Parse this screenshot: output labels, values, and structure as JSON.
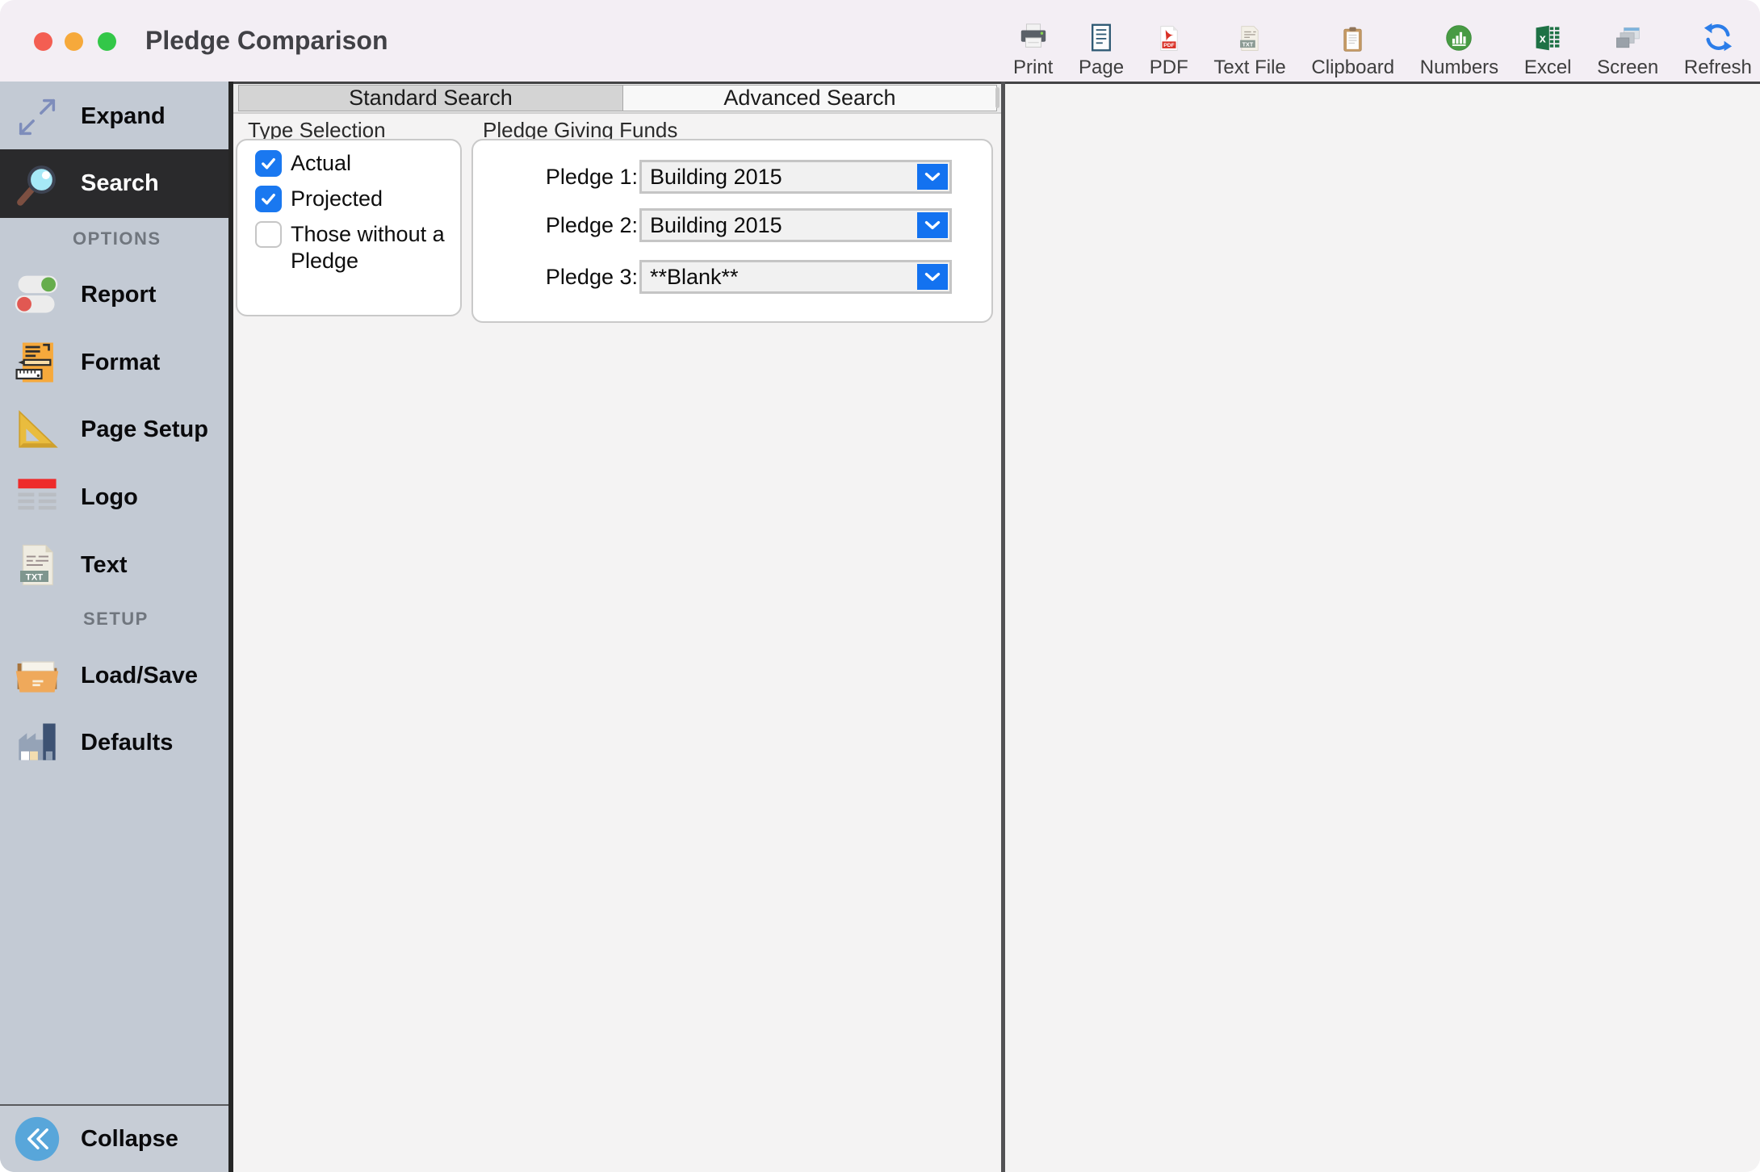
{
  "window": {
    "title": "Pledge Comparison"
  },
  "toolbar": {
    "items": [
      {
        "icon": "print-icon",
        "label": "Print"
      },
      {
        "icon": "page-icon",
        "label": "Page"
      },
      {
        "icon": "pdf-icon",
        "label": "PDF"
      },
      {
        "icon": "text-file-icon",
        "label": "Text File"
      },
      {
        "icon": "clipboard-icon",
        "label": "Clipboard"
      },
      {
        "icon": "numbers-icon",
        "label": "Numbers"
      },
      {
        "icon": "excel-icon",
        "label": "Excel"
      },
      {
        "icon": "screen-icon",
        "label": "Screen"
      },
      {
        "icon": "refresh-icon",
        "label": "Refresh"
      }
    ]
  },
  "sidebar": {
    "expand_label": "Expand",
    "search_label": "Search",
    "options_header": "OPTIONS",
    "options_items": [
      {
        "icon": "report-icon",
        "label": "Report"
      },
      {
        "icon": "format-icon",
        "label": "Format"
      },
      {
        "icon": "page-setup-icon",
        "label": "Page Setup"
      },
      {
        "icon": "logo-icon",
        "label": "Logo"
      },
      {
        "icon": "text-icon",
        "label": "Text"
      }
    ],
    "setup_header": "SETUP",
    "setup_items": [
      {
        "icon": "load-save-icon",
        "label": "Load/Save"
      },
      {
        "icon": "defaults-icon",
        "label": "Defaults"
      }
    ],
    "collapse_label": "Collapse"
  },
  "tabs": {
    "standard": "Standard Search",
    "advanced": "Advanced Search",
    "selected": "Standard Search"
  },
  "search_panel": {
    "type_selection": {
      "legend": "Type Selection",
      "options": [
        {
          "label": "Actual",
          "checked": true
        },
        {
          "label": "Projected",
          "checked": true
        },
        {
          "label": "Those without a Pledge",
          "checked": false
        }
      ]
    },
    "pledge_funds": {
      "legend": "Pledge Giving Funds",
      "rows": [
        {
          "label": "Pledge 1:",
          "value": "Building 2015"
        },
        {
          "label": "Pledge 2:",
          "value": "Building 2015"
        },
        {
          "label": "Pledge 3:",
          "value": "**Blank**"
        }
      ]
    }
  },
  "colors": {
    "accent_blue": "#1372f0",
    "checkbox_blue": "#1a78f0",
    "titlebar_bg": "#f3eef4",
    "sidebar_bg": "#c3cad4",
    "sidebar_active_bg": "#2a2a2c",
    "panel_bg": "#f4f3f3",
    "tab_selected_bg": "#d4d4d4",
    "tab_unselected_bg": "#f8f8f8",
    "collapse_circle": "#58a6da",
    "traffic_close": "#f35e52",
    "traffic_min": "#f6a93b",
    "traffic_max": "#33c748"
  }
}
